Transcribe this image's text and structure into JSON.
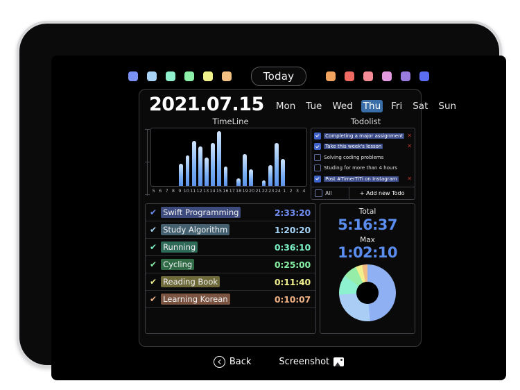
{
  "app": {
    "date": "2021.07.15",
    "today_label": "Today",
    "weekdays": [
      {
        "label": "Mon",
        "active": false
      },
      {
        "label": "Tue",
        "active": false
      },
      {
        "label": "Wed",
        "active": false
      },
      {
        "label": "Thu",
        "active": true
      },
      {
        "label": "Fri",
        "active": false
      },
      {
        "label": "Sat",
        "active": false
      },
      {
        "label": "Sun",
        "active": false
      }
    ],
    "timeline_title": "TimeLine",
    "todolist_title": "Todolist"
  },
  "palette": {
    "left_swatches": [
      "#7b93f5",
      "#a9d2f7",
      "#8ff0ce",
      "#8cf0a8",
      "#f2f28c",
      "#f2c183"
    ],
    "right_swatches": [
      "#f2a35e",
      "#ef6a62",
      "#f58b96",
      "#e29ae0",
      "#9a7be0",
      "#5b6ef2"
    ]
  },
  "chart_data": {
    "type": "bar",
    "title": "TimeLine",
    "xlabel": "",
    "ylabel": "",
    "grid": false,
    "ylim": [
      0,
      60
    ],
    "categories": [
      "5",
      "6",
      "7",
      "8",
      "9",
      "10",
      "11",
      "12",
      "13",
      "14",
      "15",
      "16",
      "17",
      "18",
      "19",
      "20",
      "21",
      "22",
      "23",
      "24",
      "1",
      "2",
      "3",
      "4"
    ],
    "values": [
      0,
      0,
      0,
      0,
      23,
      32,
      47,
      41,
      30,
      45,
      57,
      20,
      0,
      8,
      33,
      17,
      0,
      6,
      22,
      45,
      28,
      0,
      0,
      0
    ],
    "bar_color_top": "#cfe4fb",
    "bar_color_bottom": "#5b93ea"
  },
  "todolist": {
    "items": [
      {
        "text": "Completing a major assignment",
        "done": true,
        "removable": true
      },
      {
        "text": "Take this week's lesson",
        "done": true,
        "removable": true
      },
      {
        "text": "Solving coding problems",
        "done": false,
        "removable": false
      },
      {
        "text": "Studing for more than 4 hours",
        "done": false,
        "removable": false
      },
      {
        "text": "Post #TimerTiTi on Instagram",
        "done": true,
        "removable": true
      }
    ],
    "all_label": "All",
    "all_checked": false,
    "add_label": "+ Add new Todo",
    "remove_glyph": "✕"
  },
  "activities": {
    "check_glyph": "✔",
    "rows": [
      {
        "name": "Swift Programming",
        "time": "2:33:20",
        "color": "#6f8df0",
        "chip": "#3d4a7d"
      },
      {
        "name": "Study Algorithm",
        "time": "1:20:20",
        "color": "#a6d4f6",
        "chip": "#44606f"
      },
      {
        "name": "Running",
        "time": "0:36:10",
        "color": "#7bf0c4",
        "chip": "#2f6a58"
      },
      {
        "name": "Cycling",
        "time": "0:25:00",
        "color": "#86efa4",
        "chip": "#2f6b45"
      },
      {
        "name": "Reading Book",
        "time": "0:11:40",
        "color": "#eeee8a",
        "chip": "#6f6a3a"
      },
      {
        "name": "Learning Korean",
        "time": "0:10:07",
        "color": "#efb082",
        "chip": "#7a5440"
      }
    ]
  },
  "summary": {
    "total_label": "Total",
    "total_value": "5:16:37",
    "max_label": "Max",
    "max_value": "1:02:10",
    "accent": "#5b8def",
    "donut": {
      "type": "pie",
      "slices": [
        {
          "name": "Swift Programming",
          "value": 9200,
          "percent": 48.5,
          "color": "#8fb0f2"
        },
        {
          "name": "Study Algorithm",
          "value": 4820,
          "percent": 25.4,
          "color": "#a9cdf5"
        },
        {
          "name": "Running",
          "value": 2170,
          "percent": 11.4,
          "color": "#8df0cf"
        },
        {
          "name": "Cycling",
          "value": 1500,
          "percent": 7.9,
          "color": "#96eda8"
        },
        {
          "name": "Reading Book",
          "value": 700,
          "percent": 3.7,
          "color": "#f2f08c"
        },
        {
          "name": "Learning Korean",
          "value": 607,
          "percent": 3.1,
          "color": "#f2bb82"
        }
      ]
    }
  },
  "bottom": {
    "back_label": "Back",
    "screenshot_label": "Screenshot"
  }
}
